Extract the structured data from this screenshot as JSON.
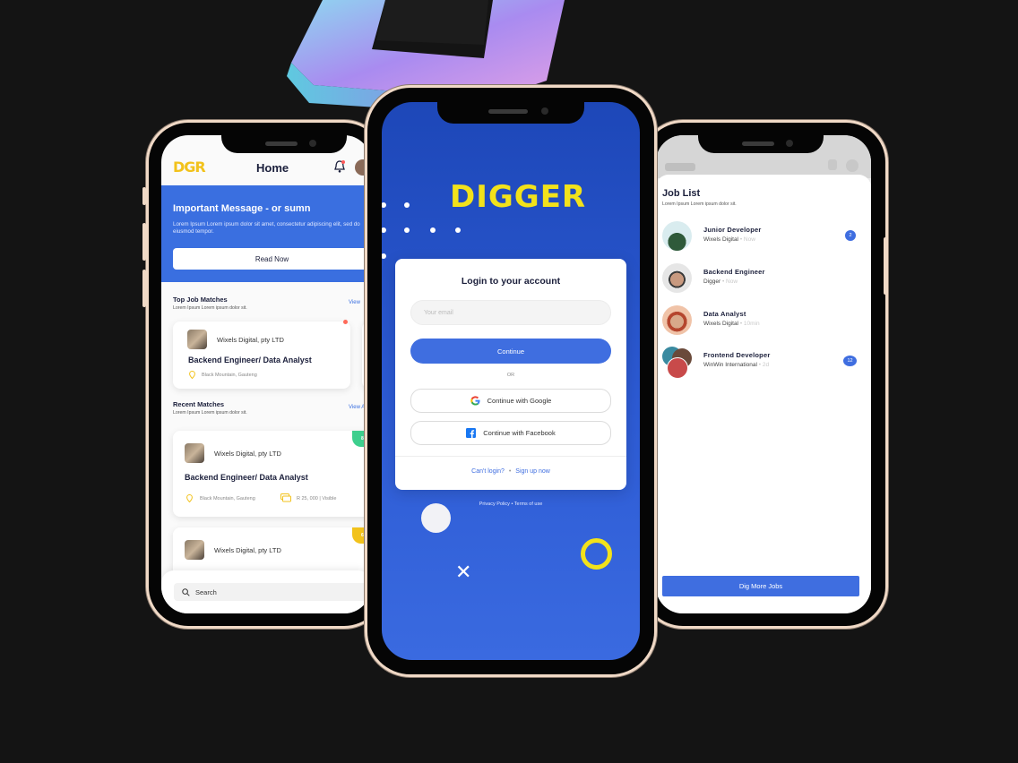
{
  "left_screen": {
    "logo": "DGR",
    "title": "Home",
    "banner": {
      "title": "Important Message - or sumn",
      "text": "Lorem Ipsum Lorem ipsum dolor sit amet, consectetur adipiscing elit, sed do eiusmod tempor.",
      "button": "Read Now"
    },
    "top_matches": {
      "title": "Top Job Matches",
      "subtitle": "Lorem Ipsum Lorem ipsum dolor sit.",
      "view_all": "View",
      "card": {
        "company": "Wixels Digital, pty LTD",
        "role": "Backend Engineer/ Data Analyst",
        "location": "Black Mountain, Gauteng"
      }
    },
    "recent_matches": {
      "title": "Recent Matches",
      "subtitle": "Lorem Ipsum Lorem ipsum dolor sit.",
      "view_all": "View A",
      "cards": [
        {
          "company": "Wixels Digital, pty LTD",
          "role": "Backend Engineer/ Data Analyst",
          "location": "Black Mountain, Gauteng",
          "salary": "R 25, 000 | Visible",
          "badge": "88%"
        },
        {
          "company": "Wixels Digital, pty LTD",
          "badge": "60%"
        }
      ]
    },
    "search_label": "Search"
  },
  "center_screen": {
    "logo": "DIGGER",
    "login_title": "Login to your account",
    "email_placeholder": "Your email",
    "continue_label": "Continue",
    "or_label": "OR",
    "google_label": "Continue with Google",
    "facebook_label": "Continue with Facebook",
    "cant_login": "Can't login?",
    "separator": "•",
    "sign_up": "Sign up now",
    "policy": "Privacy Policy • Terms of use"
  },
  "right_screen": {
    "title": "Job List",
    "subtitle": "Lorem Ipsum Lorem ipsum dolor sit.",
    "jobs": [
      {
        "role": "Junior Developer",
        "company": "Wixels Digital",
        "time": "• Now",
        "count": "2"
      },
      {
        "role": "Backend Engineer",
        "company": "Digger",
        "time": "• Now",
        "count": ""
      },
      {
        "role": "Data Analyst",
        "company": "Wixels Digital",
        "time": "• 10min",
        "count": ""
      },
      {
        "role": "Frontend Developer",
        "company": "WinWin International",
        "time": "• 2d",
        "count": "12"
      }
    ],
    "more_button": "Dig More Jobs"
  },
  "colors": {
    "primary_blue": "#3f6ee0",
    "accent_yellow": "#f2e21b",
    "success_green": "#3ecf8e",
    "background": "#141414",
    "phone_frame": "#f0d9c6"
  }
}
